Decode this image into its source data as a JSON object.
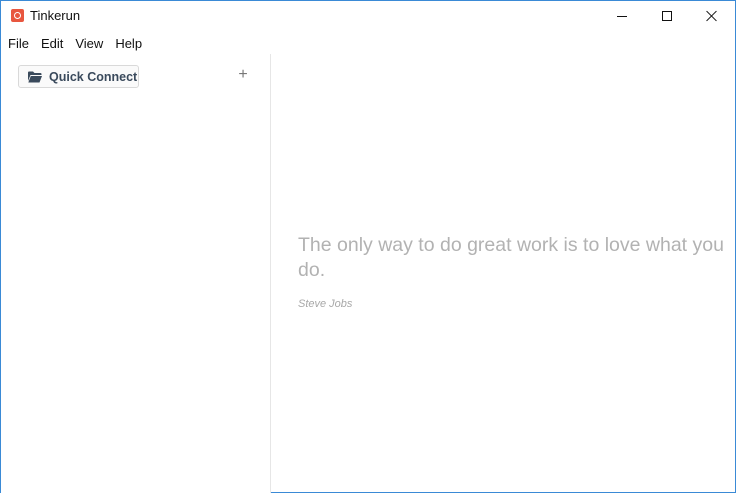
{
  "window": {
    "title": "Tinkerun",
    "app_icon": "tinkerun-app-icon",
    "accent_border": "#3a8ad6"
  },
  "controls": {
    "minimize_icon": "minimize-icon",
    "maximize_icon": "maximize-icon",
    "close_icon": "close-icon"
  },
  "menu": {
    "items": [
      {
        "label": "File"
      },
      {
        "label": "Edit"
      },
      {
        "label": "View"
      },
      {
        "label": "Help"
      }
    ]
  },
  "sidebar": {
    "quick_connect": {
      "label": "Quick Connect",
      "icon": "folder-icon"
    },
    "add_label": "+"
  },
  "main": {
    "quote": "The only way to do great work is to love what you do.",
    "author": "Steve Jobs"
  }
}
